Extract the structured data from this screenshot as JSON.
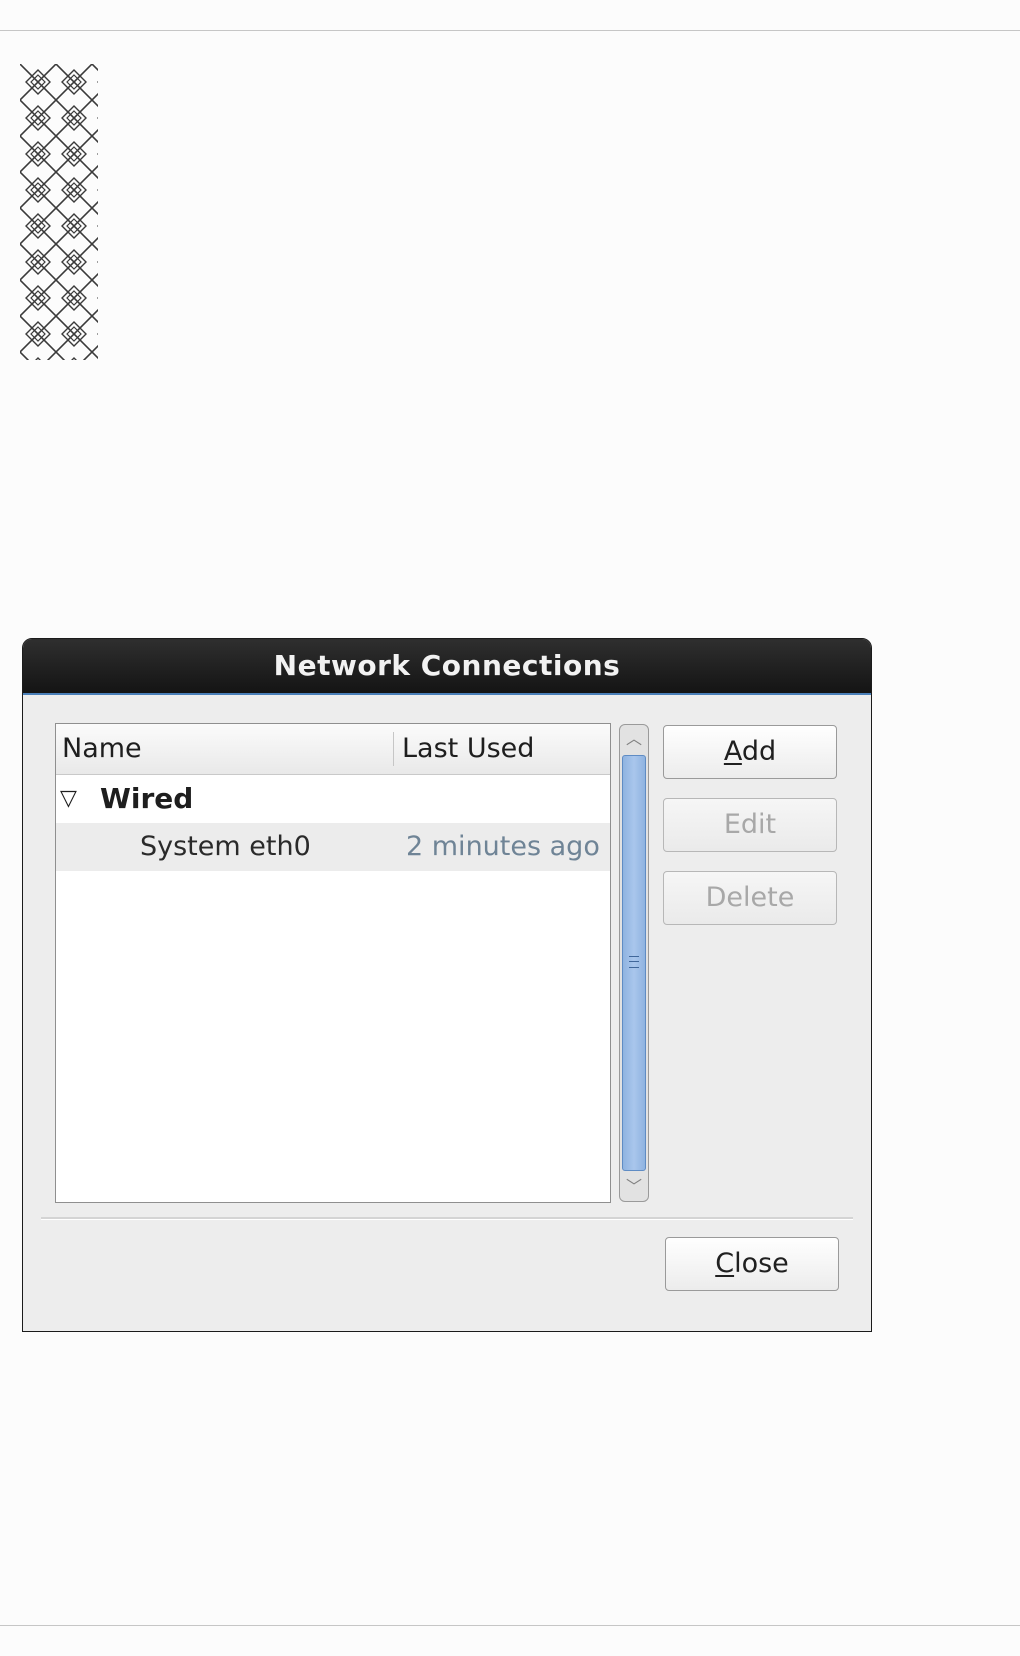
{
  "window": {
    "title": "Network Connections"
  },
  "list": {
    "columns": [
      "Name",
      "Last Used"
    ],
    "groups": [
      {
        "label": "Wired",
        "expanded": true,
        "connections": [
          {
            "name": "System eth0",
            "last_used": "2 minutes ago",
            "selected": true
          }
        ]
      }
    ]
  },
  "buttons": {
    "add": {
      "mnemonic": "A",
      "rest": "dd",
      "enabled": true
    },
    "edit": {
      "label": "Edit",
      "enabled": false
    },
    "delete": {
      "label": "Delete",
      "enabled": false
    },
    "close": {
      "mnemonic": "C",
      "rest": "lose",
      "enabled": true
    }
  },
  "colors": {
    "titlebar": "#1f1f1f",
    "scroll_thumb": "#9dbde6",
    "secondary_text": "#6f8496"
  }
}
